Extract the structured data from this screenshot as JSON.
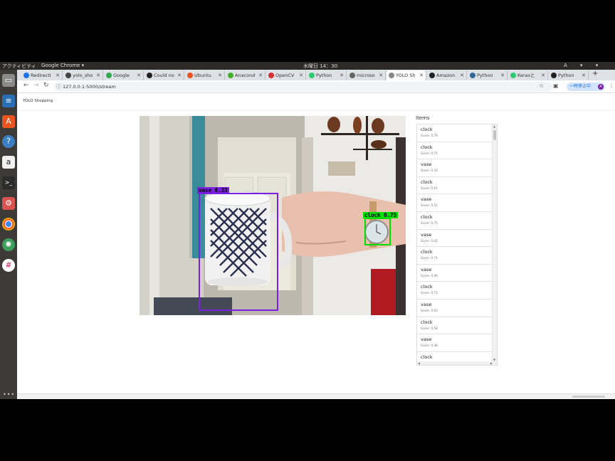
{
  "topbar": {
    "activities": "アクティビティ",
    "app_name": "Google Chrome ▾",
    "clock": "水曜日 14：30",
    "indicators": "A ▾ ▾ ▾"
  },
  "tabs": [
    {
      "label": "RedirectI",
      "color": "#1a73e8"
    },
    {
      "label": "yolo_sho",
      "color": "#444"
    },
    {
      "label": "Google",
      "color": "#34a853"
    },
    {
      "label": "Could no",
      "color": "#222"
    },
    {
      "label": "Ubuntu",
      "color": "#e95420"
    },
    {
      "label": "Anacond",
      "color": "#43b02a"
    },
    {
      "label": "OpenCV",
      "color": "#d63031"
    },
    {
      "label": "Python",
      "color": "#2ecc71"
    },
    {
      "label": "microso",
      "color": "#666"
    },
    {
      "label": "YOLO Sh",
      "color": "#888"
    },
    {
      "label": "Amazon",
      "color": "#222"
    },
    {
      "label": "Python",
      "color": "#306998"
    },
    {
      "label": "Kerasと",
      "color": "#2ecc71"
    },
    {
      "label": "Python",
      "color": "#222"
    }
  ],
  "toolbar": {
    "url": "127.0.0.1:5000/stream",
    "pause_label": "一時停止中",
    "avatar_letter": "A"
  },
  "page": {
    "brand": "YOLO Shopping"
  },
  "detections": [
    {
      "label": "vase 0.33",
      "color": "#7b1fe0"
    },
    {
      "label": "clock 0.75",
      "color": "#00dd00"
    }
  ],
  "items_panel": {
    "title": "Items",
    "items": [
      {
        "name": "clock",
        "score": "Score: 0.79"
      },
      {
        "name": "clock",
        "score": "Score: 0.75"
      },
      {
        "name": "vase",
        "score": "Score: 0.33"
      },
      {
        "name": "clock",
        "score": "Score: 0.67"
      },
      {
        "name": "vase",
        "score": "Score: 0.52"
      },
      {
        "name": "clock",
        "score": "Score: 0.75"
      },
      {
        "name": "vase",
        "score": "Score: 0.42"
      },
      {
        "name": "clock",
        "score": "Score: 0.74"
      },
      {
        "name": "vase",
        "score": "Score: 0.46"
      },
      {
        "name": "clock",
        "score": "Score: 0.73"
      },
      {
        "name": "vase",
        "score": "Score: 0.63"
      },
      {
        "name": "clock",
        "score": "Score: 0.58"
      },
      {
        "name": "vase",
        "score": "Score: 0.48"
      },
      {
        "name": "clock",
        "score": ""
      }
    ]
  },
  "dock_icons": [
    "files-icon",
    "writer-icon",
    "software-icon",
    "help-icon",
    "amazon-icon",
    "terminal-icon",
    "settings-icon",
    "chrome-icon",
    "atom-icon",
    "slack-icon"
  ]
}
